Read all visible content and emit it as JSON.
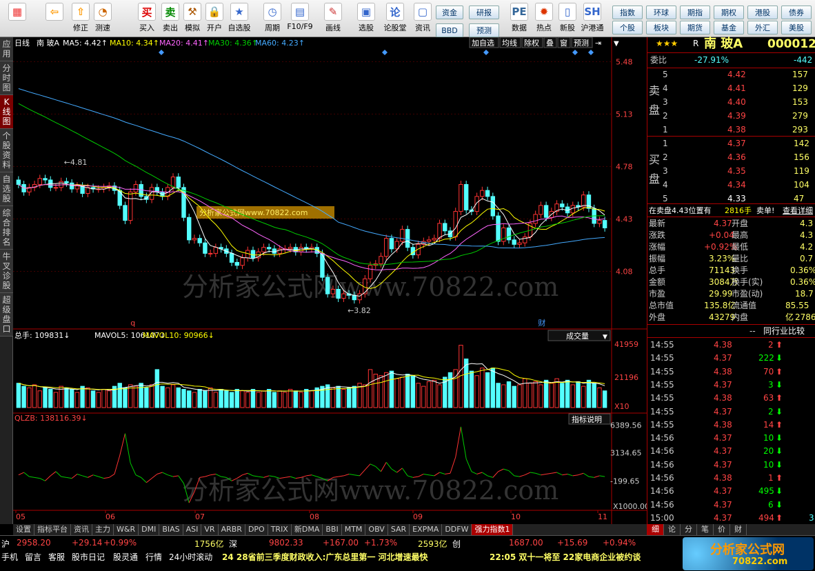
{
  "toolbar": {
    "tools": [
      {
        "label": "",
        "icon": "grid-icon"
      },
      {
        "label": "",
        "icon": "back-arrow-icon"
      },
      {
        "label": "修正",
        "icon": "revise-icon"
      },
      {
        "label": "测速",
        "icon": "speed-test-icon"
      },
      {
        "label": "买入",
        "icon": "buy-icon"
      },
      {
        "label": "卖出",
        "icon": "sell-icon"
      },
      {
        "label": "模拟",
        "icon": "simulate-icon"
      },
      {
        "label": "开户",
        "icon": "lock-icon"
      },
      {
        "label": "自选股",
        "icon": "favorites-icon"
      },
      {
        "label": "周期",
        "icon": "clock-icon"
      },
      {
        "label": "F10/F9",
        "icon": "f10-icon"
      },
      {
        "label": "画线",
        "icon": "pen-icon"
      },
      {
        "label": "选股",
        "icon": "select-stock-icon"
      },
      {
        "label": "论股堂",
        "icon": "forum-icon"
      },
      {
        "label": "资讯",
        "icon": "info-icon"
      },
      {
        "label": "数据",
        "icon": "pe-data-icon"
      },
      {
        "label": "热点",
        "icon": "hot-icon"
      },
      {
        "label": "新股",
        "icon": "new-stock-icon"
      },
      {
        "label": "沪港通",
        "icon": "shhk-icon"
      }
    ],
    "btn_zijin": "资金",
    "btn_yanbao": "研报",
    "btn_bbd": "BBD",
    "btn_yuce": "预测",
    "right_buttons": [
      "指数",
      "环球",
      "期指",
      "期权",
      "港股",
      "债券",
      "个股",
      "板块",
      "期货",
      "基金",
      "外汇",
      "美股"
    ]
  },
  "sidetabs": [
    "应用",
    "分时图",
    "K线图",
    "个股资料",
    "自选股",
    "综合排名",
    "牛叉诊股",
    "超级盘口"
  ],
  "chart_header": {
    "period": "日线",
    "name": "南 玻A",
    "ma5": "MA5: 4.42↑",
    "ma10": "MA10: 4.34↑",
    "ma20": "MA20: 4.41↑",
    "ma30": "MA30: 4.36↑",
    "ma60": "MA60: 4.23↑"
  },
  "chart_buttons": [
    "加自选",
    "均线",
    "除权",
    "叠",
    "窗",
    "预测"
  ],
  "colors": {
    "up": "#ff3333",
    "down": "#54ffff",
    "ma5": "#ffffff",
    "ma10": "#ffff00",
    "ma20": "#ff66ff",
    "ma30": "#00cc00",
    "ma60": "#44aaff",
    "border": "#aa0000"
  },
  "chart_data": [
    {
      "type": "candlestick",
      "name": "price",
      "y_ticks": [
        "5.48",
        "5.13",
        "4.78",
        "4.43",
        "4.08"
      ],
      "annotations": {
        "high": "4.81",
        "low": "3.82"
      },
      "x_labels": [
        "05",
        "06",
        "07",
        "08",
        "09",
        "10",
        "11"
      ],
      "markers": [
        "q",
        "财"
      ],
      "close": [
        4.66,
        4.61,
        4.64,
        4.66,
        4.7,
        4.69,
        4.64,
        4.64,
        4.68,
        4.67,
        4.63,
        4.65,
        4.6,
        4.64,
        4.63,
        4.63,
        4.64,
        4.65,
        4.62,
        4.52,
        4.42,
        4.61,
        4.66,
        4.58,
        4.56,
        4.64,
        4.61,
        4.58,
        4.64,
        4.71,
        4.64,
        4.44,
        4.29,
        4.3,
        4.27,
        4.2,
        4.2,
        4.24,
        4.23,
        4.2,
        4.14,
        4.12,
        4.17,
        4.22,
        4.17,
        4.21,
        4.24,
        4.23,
        4.2,
        4.23,
        4.23,
        4.24,
        4.21,
        4.24,
        4.23,
        4.24,
        4.2,
        4.04,
        3.93,
        3.96,
        3.9,
        3.93,
        3.92,
        3.89,
        3.93,
        4.03,
        4.12,
        4.13,
        4.18,
        4.3,
        4.23,
        4.28,
        4.36,
        4.24,
        4.19,
        4.26,
        4.28,
        4.29,
        4.3,
        4.4,
        4.35,
        4.31,
        4.48,
        4.66,
        4.49,
        4.48,
        4.58,
        4.62,
        4.58,
        4.45,
        4.28,
        4.37,
        4.29,
        4.26,
        4.27,
        4.31,
        4.4,
        4.46,
        4.52,
        4.44,
        4.48,
        4.53,
        4.51,
        4.47,
        4.52,
        4.51,
        4.59,
        4.5,
        4.4,
        4.42,
        4.37
      ]
    },
    {
      "type": "bar",
      "name": "volume",
      "legend": {
        "main": "总手: 109831↓",
        "mavol5": "MAVOL5: 106107↓",
        "mavol10": "MAVOL10: 90966↓"
      },
      "indicator_label": "成交量",
      "y_ticks": [
        "41959",
        "21196"
      ],
      "unit": "X10",
      "values": [
        1.6,
        1.4,
        1.3,
        1.5,
        1.1,
        1.3,
        1.2,
        1.0,
        1.4,
        1.3,
        1.2,
        1.0,
        1.4,
        1.3,
        1.1,
        1.0,
        1.2,
        1.1,
        1.4,
        1.6,
        1.3,
        1.5,
        1.4,
        1.6,
        1.3,
        1.5,
        2.5,
        1.4,
        1.3,
        1.5,
        1.3,
        1.2,
        1.1,
        1.0,
        1.2,
        1.1,
        1.3,
        1.0,
        1.2,
        1.1,
        1.0,
        1.2,
        1.1,
        1.0,
        1.2,
        1.0,
        1.1,
        1.2,
        1.0,
        1.1,
        1.0,
        1.2,
        1.1,
        1.0,
        1.2,
        1.1,
        1.3,
        1.4,
        1.5,
        1.3,
        1.4,
        1.2,
        1.3,
        1.4,
        1.6,
        1.5,
        2.5,
        2.2,
        2.1,
        2.3,
        2.4,
        1.9,
        2.0,
        2.2,
        2.1,
        1.6,
        1.4,
        1.7,
        1.8,
        1.5,
        2.0,
        2.3,
        2.5,
        4.1,
        3.2,
        2.4,
        2.1,
        2.6,
        2.3,
        2.6,
        1.6,
        1.5,
        1.7,
        1.4,
        1.5,
        1.9,
        1.6,
        1.7,
        1.5,
        1.8,
        1.6,
        1.9,
        1.6,
        1.8,
        1.5,
        1.7,
        1.4,
        1.8,
        1.6,
        1.3,
        1.1
      ]
    },
    {
      "type": "line",
      "name": "QLZB",
      "legend": "QLZB: 138116.39↓",
      "explain": "指标说明",
      "y_ticks": [
        "6389.56",
        "3134.65",
        "-199.65"
      ],
      "unit": "X1000.00",
      "values": [
        0.5,
        0.8,
        0.3,
        0.2,
        0.1,
        -0.2,
        0.4,
        0.9,
        0.3,
        0.2,
        0.1,
        0.6,
        0.4,
        0.2,
        0.5,
        0.3,
        0.1,
        0.2,
        0.6,
        2.8,
        5.4,
        1.9,
        0.5,
        0.2,
        -0.4,
        0.1,
        0.6,
        0.8,
        0.5,
        0.3,
        0.4,
        -0.5,
        -2.8,
        -1.5,
        0.2,
        0.3,
        0.5,
        0.6,
        0.3,
        0.2,
        -0.2,
        0.1,
        0.5,
        0.7,
        0.4,
        0.3,
        0.2,
        0.4,
        0.3,
        0.1,
        0.2,
        0.3,
        0.1,
        0.2,
        0.4,
        0.5,
        0.3,
        0.1,
        -0.2,
        0.2,
        0.3,
        0.4,
        0.6,
        0.5,
        0.4,
        1.1,
        1.8,
        1.5,
        0.9,
        2.0,
        1.2,
        0.8,
        1.3,
        0.4,
        0.2,
        0.3,
        0.6,
        0.5,
        0.4,
        0.8,
        0.6,
        0.7,
        2.6,
        6.2,
        2.4,
        0.9,
        0.6,
        0.8,
        0.4,
        0.2,
        0.9,
        1.2,
        1.0,
        0.4,
        0.3,
        0.5,
        0.8,
        0.7,
        0.5,
        0.6,
        0.7,
        0.8,
        0.5,
        0.6,
        0.4,
        0.5,
        0.7,
        0.3,
        0.2,
        0.4,
        0.3
      ]
    }
  ],
  "watermark": "分析家公式网www.70822.com",
  "watermark_small": "分析家公式网www.70822.com",
  "bottom_tabs": [
    "设置",
    "指标平台",
    "资讯",
    "主力",
    "W&R",
    "DMI",
    "BIAS",
    "ASI",
    "VR",
    "ARBR",
    "DPO",
    "TRIX",
    "新DMA",
    "BBI",
    "MTM",
    "OBV",
    "SAR",
    "EXPMA",
    "DDFW",
    "强力指数1"
  ],
  "quote": {
    "stars": "★★★",
    "code_prefix": "R",
    "name": "南 玻A",
    "code": "000012",
    "weibi_label": "委比",
    "weibi_pct": "-27.91%",
    "weibi_diff": "-442",
    "sell_label": "卖盘",
    "buy_label": "买盘",
    "sells": [
      {
        "level": "5",
        "price": "4.42",
        "vol": "157"
      },
      {
        "level": "4",
        "price": "4.41",
        "vol": "129"
      },
      {
        "level": "3",
        "price": "4.40",
        "vol": "153"
      },
      {
        "level": "2",
        "price": "4.39",
        "vol": "279"
      },
      {
        "level": "1",
        "price": "4.38",
        "vol": "293"
      }
    ],
    "buys": [
      {
        "level": "1",
        "price": "4.37",
        "vol": "142"
      },
      {
        "level": "2",
        "price": "4.36",
        "vol": "156"
      },
      {
        "level": "3",
        "price": "4.35",
        "vol": "119"
      },
      {
        "level": "4",
        "price": "4.34",
        "vol": "104"
      },
      {
        "level": "5",
        "price": "4.33",
        "vol": "47"
      }
    ],
    "inqueue_a": "在卖盘4.43位置有",
    "inqueue_b": "2816手",
    "inqueue_c": "卖单!",
    "inqueue_d": "查看详细",
    "stats": [
      {
        "l1": "最新",
        "v1": "4.37",
        "l2": "开盘",
        "v2": "4.3"
      },
      {
        "l1": "涨跌",
        "v1": "+0.04",
        "l2": "最高",
        "v2": "4.3"
      },
      {
        "l1": "涨幅",
        "v1": "+0.92%",
        "l2": "最低",
        "v2": "4.2"
      },
      {
        "l1": "振幅",
        "v1": "3.23%",
        "l2": "量比",
        "v2": "0.7"
      },
      {
        "l1": "总手",
        "v1": "71143",
        "l2": "换手",
        "v2": "0.36%"
      },
      {
        "l1": "金额",
        "v1": "3084万",
        "l2": "换手(实)",
        "v2": "0.36%"
      },
      {
        "l1": "市盈",
        "v1": "29.99",
        "l2": "市盈(动)",
        "v2": "18.7"
      },
      {
        "l1": "总市值",
        "v1": "135.8亿",
        "l2": "流通值",
        "v2": "85.55亿"
      },
      {
        "l1": "外盘",
        "v1": "43279",
        "l2": "内盘",
        "v2": "2786"
      }
    ],
    "industry_dash": "--",
    "industry_btn": "同行业比较",
    "ticks": [
      {
        "time": "14:55",
        "price": "4.38",
        "vol": "2",
        "dir": "up"
      },
      {
        "time": "14:55",
        "price": "4.37",
        "vol": "222",
        "dir": "down"
      },
      {
        "time": "14:55",
        "price": "4.38",
        "vol": "70",
        "dir": "up"
      },
      {
        "time": "14:55",
        "price": "4.37",
        "vol": "3",
        "dir": "down"
      },
      {
        "time": "14:55",
        "price": "4.38",
        "vol": "63",
        "dir": "up"
      },
      {
        "time": "14:55",
        "price": "4.37",
        "vol": "2",
        "dir": "down"
      },
      {
        "time": "14:55",
        "price": "4.38",
        "vol": "14",
        "dir": "up"
      },
      {
        "time": "14:56",
        "price": "4.37",
        "vol": "10",
        "dir": "down"
      },
      {
        "time": "14:56",
        "price": "4.37",
        "vol": "20",
        "dir": "down"
      },
      {
        "time": "14:56",
        "price": "4.37",
        "vol": "10",
        "dir": "down"
      },
      {
        "time": "14:56",
        "price": "4.38",
        "vol": "1",
        "dir": "up"
      },
      {
        "time": "14:56",
        "price": "4.37",
        "vol": "495",
        "dir": "down"
      },
      {
        "time": "14:56",
        "price": "4.37",
        "vol": "6",
        "dir": "down"
      },
      {
        "time": "15:00",
        "price": "4.37",
        "vol": "494",
        "dir": "up",
        "extra": "3"
      }
    ],
    "tabs": [
      "细",
      "论",
      "分",
      "笔",
      "价",
      "财"
    ]
  },
  "statusbar": {
    "sh_label": "沪",
    "sh_index": "2958.20",
    "sh_chg": "+29.14",
    "sh_pct": "+0.99%",
    "sh_amount": "1756亿",
    "sz_label": "深",
    "sz_index": "9802.33",
    "sz_chg": "+167.00",
    "sz_pct": "+1.73%",
    "sz_amount": "2593亿",
    "cy_label": "创",
    "cy_index": "1687.00",
    "cy_chg": "+15.69",
    "cy_pct": "+0.94%",
    "links": [
      "手机",
      "留言",
      "客服",
      "股市日记",
      "股灵通",
      "行情",
      "24小时滚动"
    ],
    "news1": "24 28省前三季度财政收入:广东总里第一 河北增速最快",
    "news2": "22:05 双十一将至 22家电商企业被约谈",
    "logo_text": "分析家公式网",
    "logo_url": "70822.com"
  }
}
